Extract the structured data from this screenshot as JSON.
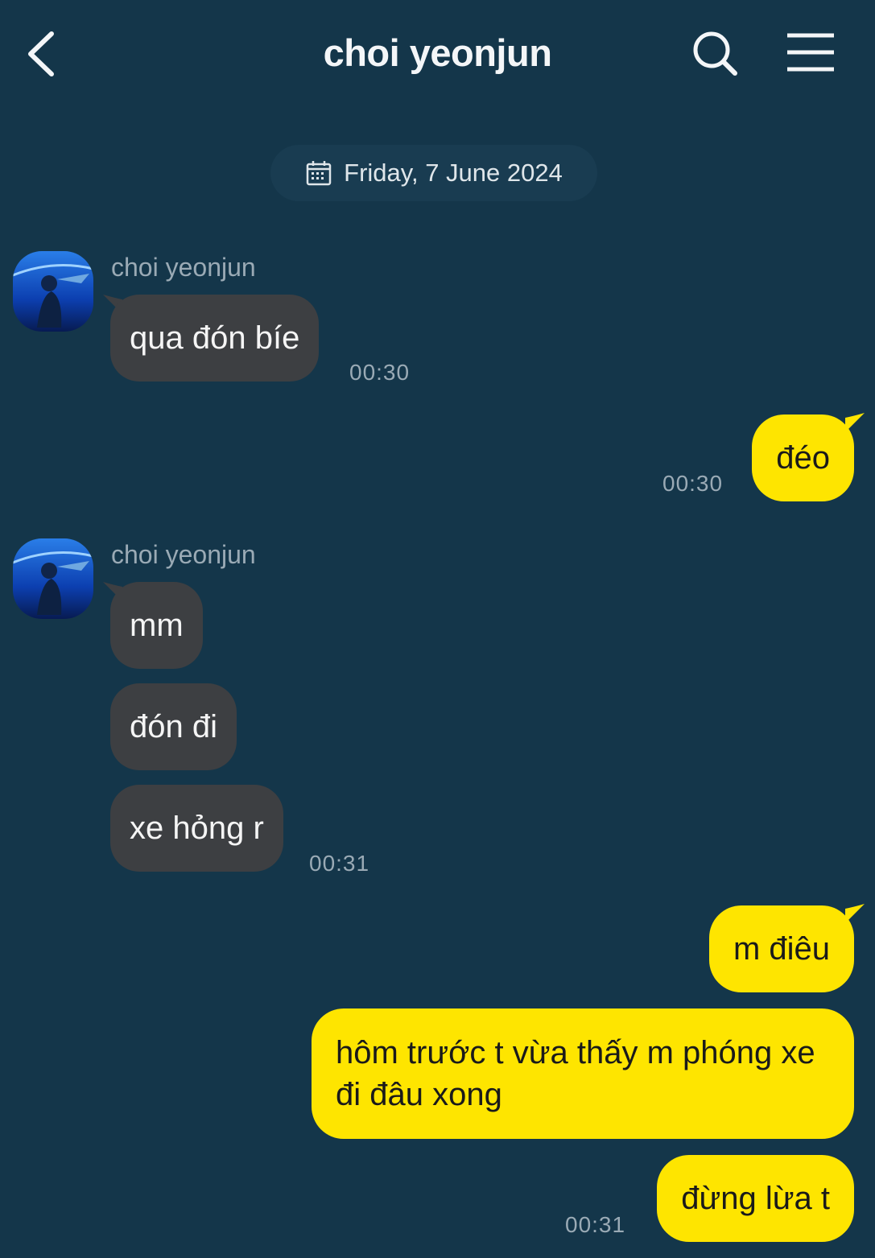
{
  "header": {
    "title": "choi yeonjun",
    "back_icon": "chevron-left-icon",
    "search_icon": "search-icon",
    "menu_icon": "hamburger-menu-icon"
  },
  "date_divider": {
    "label": "Friday, 7 June 2024",
    "icon": "calendar-icon"
  },
  "messages": [
    {
      "sender": "choi yeonjun",
      "texts": [
        "qua đón bíe"
      ],
      "time": "00:30"
    },
    {
      "sender": "me",
      "texts": [
        "đéo"
      ],
      "time": "00:30"
    },
    {
      "sender": "choi yeonjun",
      "texts": [
        "mm",
        "đón đi",
        "xe hỏng r"
      ],
      "time": "00:31"
    },
    {
      "sender": "me",
      "texts": [
        "m điêu",
        "hôm trước t vừa thấy m phóng xe đi đâu xong",
        "đừng lừa t"
      ],
      "time": "00:31"
    }
  ],
  "colors": {
    "background": "#14364a",
    "incoming_bubble": "#3d3f42",
    "outgoing_bubble": "#fee500",
    "meta_text": "#9aaab5"
  }
}
